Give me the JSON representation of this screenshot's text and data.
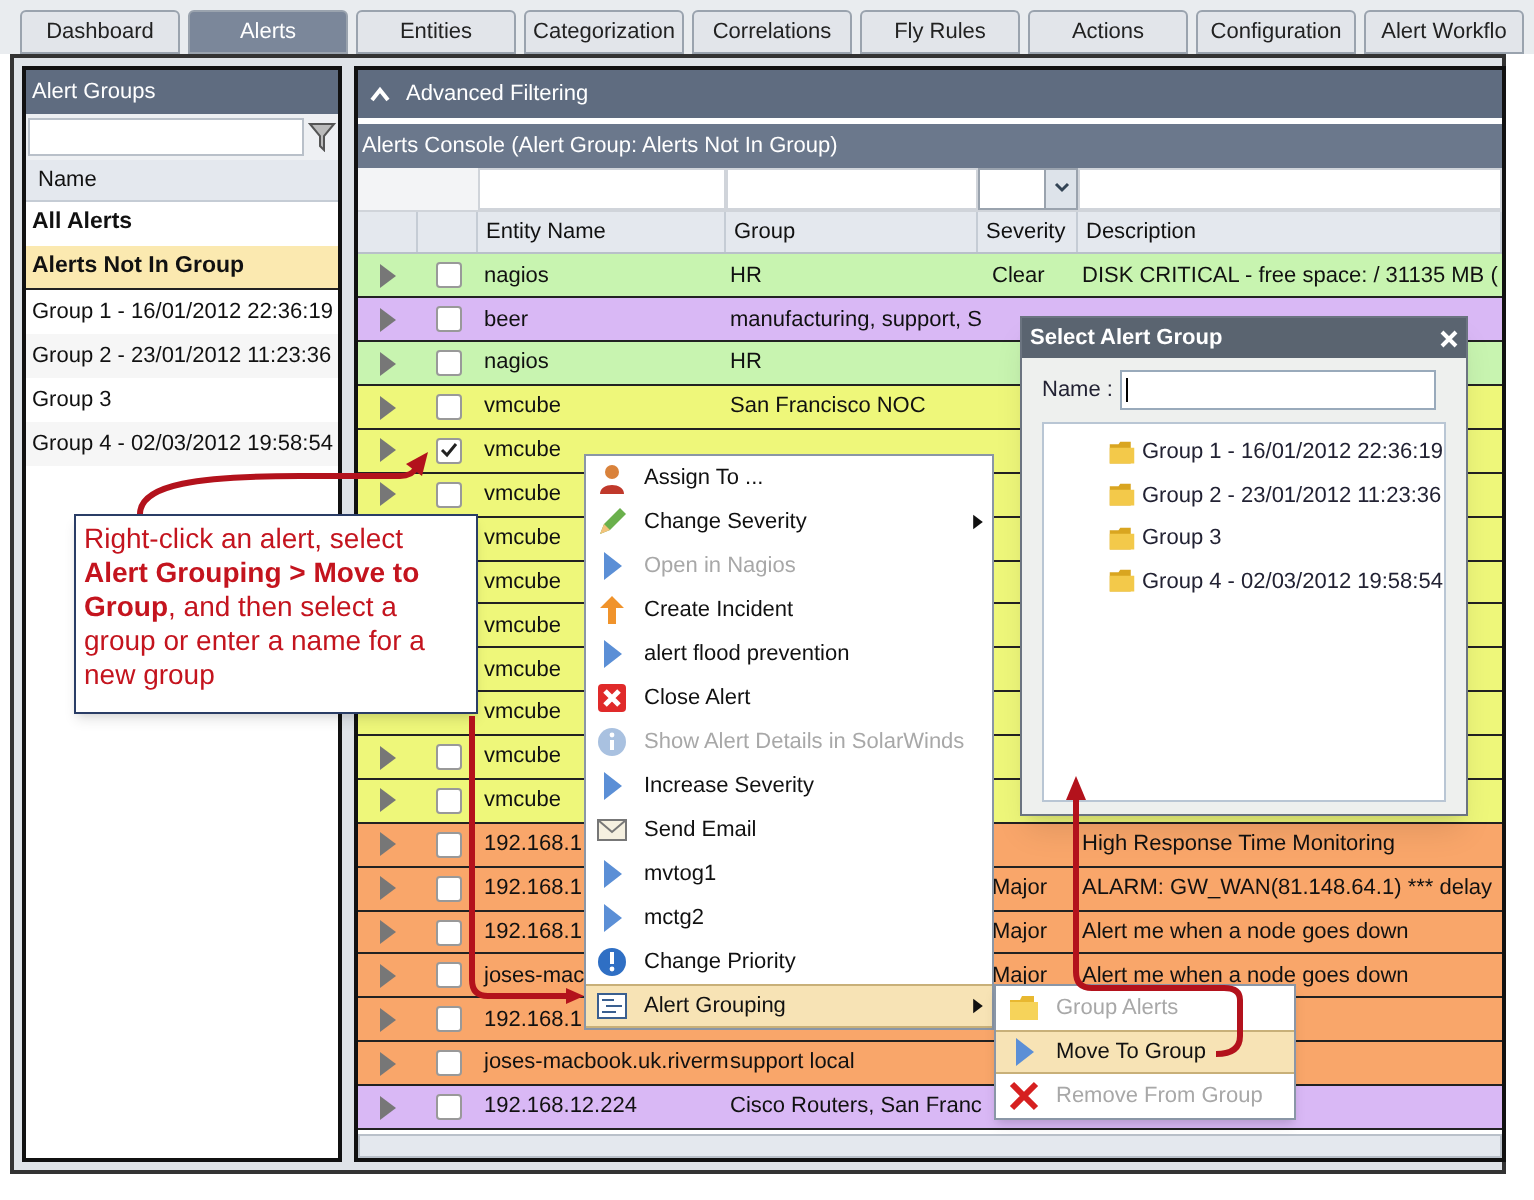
{
  "tabs": [
    {
      "label": "Dashboard",
      "selected": false
    },
    {
      "label": "Alerts",
      "selected": true
    },
    {
      "label": "Entities",
      "selected": false
    },
    {
      "label": "Categorization",
      "selected": false
    },
    {
      "label": "Correlations",
      "selected": false
    },
    {
      "label": "Fly Rules",
      "selected": false
    },
    {
      "label": "Actions",
      "selected": false
    },
    {
      "label": "Configuration",
      "selected": false
    },
    {
      "label": "Alert Workflo",
      "selected": false
    }
  ],
  "sidebar": {
    "title": "Alert Groups",
    "column": "Name",
    "items": [
      {
        "label": "All Alerts",
        "bold": true,
        "selected": false
      },
      {
        "label": "Alerts Not In Group",
        "bold": true,
        "selected": true
      },
      {
        "label": "Group 1 - 16/01/2012 22:36:19",
        "bold": false,
        "selected": false
      },
      {
        "label": "Group 2 - 23/01/2012 11:23:36",
        "bold": false,
        "selected": false
      },
      {
        "label": "Group 3",
        "bold": false,
        "selected": false
      },
      {
        "label": "Group 4 - 02/03/2012 19:58:54",
        "bold": false,
        "selected": false
      }
    ]
  },
  "filter_panel": {
    "title": "Advanced Filtering",
    "expanded": true
  },
  "console": {
    "title": "Alerts Console (Alert Group: Alerts Not In Group)",
    "columns": [
      "Entity Name",
      "Group",
      "Severity",
      "Description"
    ],
    "rows": [
      {
        "entity": "nagios",
        "group": "HR",
        "severity": "Clear",
        "description": "DISK CRITICAL - free space: / 31135 MB (",
        "checked": false,
        "color": "#c8f4b0"
      },
      {
        "entity": "beer",
        "group": "manufacturing, support, S",
        "checked": false,
        "color": "#d9b8f5"
      },
      {
        "entity": "nagios",
        "group": "HR",
        "checked": false,
        "color": "#c8f4b0"
      },
      {
        "entity": "vmcube",
        "group": "San Francisco NOC",
        "checked": false,
        "color": "#eef77a"
      },
      {
        "entity": "vmcube",
        "checked": true,
        "color": "#eef77a"
      },
      {
        "entity": "vmcube",
        "checked": false,
        "color": "#eef77a"
      },
      {
        "entity": "vmcube",
        "color": "#eef77a"
      },
      {
        "entity": "vmcube",
        "color": "#eef77a"
      },
      {
        "entity": "vmcube",
        "color": "#eef77a"
      },
      {
        "entity": "vmcube",
        "color": "#eef77a"
      },
      {
        "entity": "vmcube",
        "color": "#eef77a"
      },
      {
        "entity": "vmcube",
        "checked": false,
        "color": "#eef77a"
      },
      {
        "entity": "vmcube",
        "checked": false,
        "color": "#eef77a"
      },
      {
        "entity": "192.168.1",
        "description": "High Response Time Monitoring",
        "checked": false,
        "color": "#f9a66a"
      },
      {
        "entity": "192.168.1",
        "severity": "Major",
        "description": "ALARM: GW_WAN(81.148.64.1) *** delay",
        "checked": false,
        "color": "#f9a66a"
      },
      {
        "entity": "192.168.1",
        "severity": "Major",
        "description": "Alert me when a node goes down",
        "checked": false,
        "color": "#f9a66a"
      },
      {
        "entity": "joses-mac",
        "severity": "Major",
        "description": "Alert me when a node goes down",
        "checked": false,
        "color": "#f9a66a"
      },
      {
        "entity": "192.168.1",
        "checked": false,
        "color": "#f9a66a"
      },
      {
        "entity": "joses-macbook.uk.riverm",
        "group": "support local",
        "checked": false,
        "color": "#f9a66a"
      },
      {
        "entity": "192.168.12.224",
        "group": "Cisco Routers, San Franc",
        "checked": false,
        "color": "#d9b8f5"
      }
    ]
  },
  "context_menu": {
    "items": [
      {
        "label": "Assign To ...",
        "kind": "user",
        "disabled": false,
        "submenu": false,
        "selected": false
      },
      {
        "label": "Change Severity",
        "kind": "pencil",
        "disabled": false,
        "submenu": true,
        "selected": false
      },
      {
        "label": "Open in Nagios",
        "kind": "play",
        "disabled": true,
        "submenu": false,
        "selected": false
      },
      {
        "label": "Create Incident",
        "kind": "up",
        "disabled": false,
        "submenu": false,
        "selected": false
      },
      {
        "label": "alert flood prevention",
        "kind": "play",
        "disabled": false,
        "submenu": false,
        "selected": false
      },
      {
        "label": "Close Alert",
        "kind": "close",
        "disabled": false,
        "submenu": false,
        "selected": false
      },
      {
        "label": "Show Alert Details in SolarWinds",
        "kind": "info",
        "disabled": true,
        "submenu": false,
        "selected": false
      },
      {
        "label": "Increase Severity",
        "kind": "play",
        "disabled": false,
        "submenu": false,
        "selected": false
      },
      {
        "label": "Send Email",
        "kind": "mail",
        "disabled": false,
        "submenu": false,
        "selected": false
      },
      {
        "label": "mvtog1",
        "kind": "play",
        "disabled": false,
        "submenu": false,
        "selected": false
      },
      {
        "label": "mctg2",
        "kind": "play",
        "disabled": false,
        "submenu": false,
        "selected": false
      },
      {
        "label": "Change Priority",
        "kind": "priority",
        "disabled": false,
        "submenu": false,
        "selected": false
      },
      {
        "label": "Alert Grouping",
        "kind": "list",
        "disabled": false,
        "submenu": true,
        "selected": true
      }
    ]
  },
  "submenu": {
    "items": [
      {
        "label": "Group Alerts",
        "kind": "folder",
        "disabled": true,
        "selected": false
      },
      {
        "label": "Move To Group",
        "kind": "play",
        "disabled": false,
        "selected": true
      },
      {
        "label": "Remove From Group",
        "kind": "cross",
        "disabled": true,
        "selected": false
      }
    ]
  },
  "dialog": {
    "title": "Select Alert Group",
    "name_label": "Name :",
    "groups": [
      "Group 1 - 16/01/2012 22:36:19",
      "Group 2 - 23/01/2012 11:23:36",
      "Group 3",
      "Group 4 - 02/03/2012 19:58:54"
    ]
  },
  "callout": {
    "text": "Right-click an alert, select **Alert Grouping > Move to Group**, and then select a group or enter a name for a new group"
  }
}
